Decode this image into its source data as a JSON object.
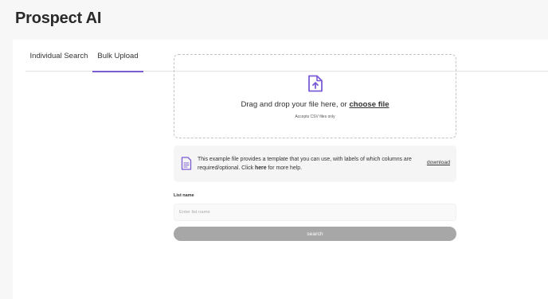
{
  "app": {
    "title": "Prospect AI"
  },
  "tabs": [
    {
      "label": "Individual Search",
      "active": false
    },
    {
      "label": "Bulk Upload",
      "active": true
    }
  ],
  "dropzone": {
    "icon": "file-upload-icon",
    "text_before": "Drag and drop your file here, or ",
    "choose_label": "choose file",
    "accepts": "Accepts CSV files only"
  },
  "example": {
    "icon": "document-icon",
    "text_before": "This example file provides a template that you can use, with labels of which columns are required/optional. Click ",
    "here_label": "here",
    "text_after": " for more help.",
    "download_label": "download"
  },
  "list": {
    "label": "List name",
    "placeholder": "Enter list name",
    "value": ""
  },
  "search_label": "search",
  "colors": {
    "accent": "#7b5cd6",
    "button": "#a7a7a7",
    "background": "#f7f7f7"
  }
}
